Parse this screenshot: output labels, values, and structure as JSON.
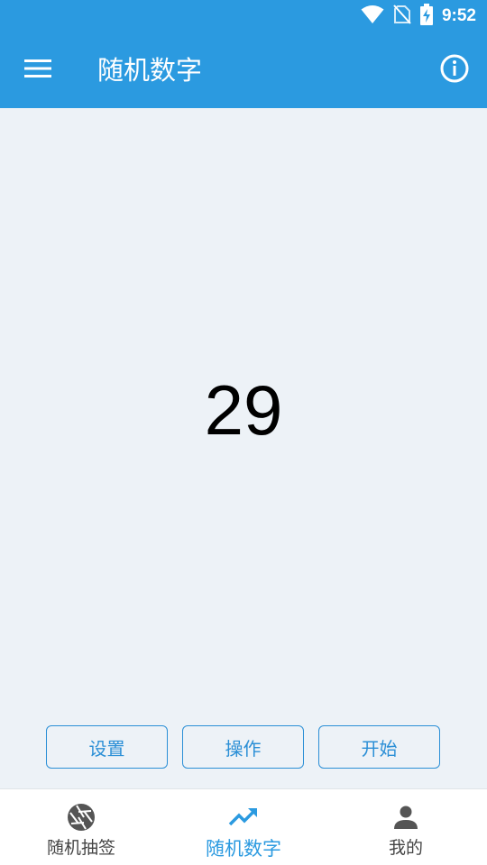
{
  "status_bar": {
    "time": "9:52",
    "icons": [
      "wifi-icon",
      "no-sim-icon",
      "battery-charging-icon"
    ]
  },
  "app_bar": {
    "title": "随机数字",
    "menu_icon": "menu-icon",
    "info_icon": "info-icon"
  },
  "main": {
    "number": "29"
  },
  "actions": {
    "settings_label": "设置",
    "operate_label": "操作",
    "start_label": "开始"
  },
  "bottom_nav": {
    "items": [
      {
        "label": "随机抽签",
        "icon": "aperture-icon",
        "active": false
      },
      {
        "label": "随机数字",
        "icon": "trending-up-icon",
        "active": true
      },
      {
        "label": "我的",
        "icon": "person-icon",
        "active": false
      }
    ]
  },
  "colors": {
    "primary": "#2b9ae0",
    "background": "#edf2f7",
    "button_border": "#2b8fd6",
    "inactive_nav": "#555555"
  }
}
